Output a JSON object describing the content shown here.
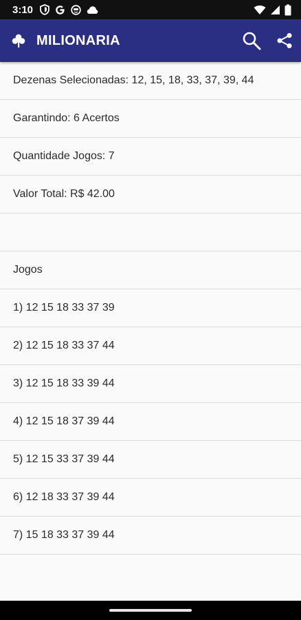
{
  "status_bar": {
    "time": "3:10",
    "left_icons": [
      "shield-icon",
      "google-icon",
      "face-icon",
      "cloud-icon"
    ],
    "right_icons": [
      "wifi-icon",
      "signal-icon",
      "battery-icon"
    ]
  },
  "app_bar": {
    "title": "MILIONARIA",
    "background": "#2b2f84",
    "logo_icon": "clover-icon",
    "actions": [
      "search-icon",
      "share-icon"
    ]
  },
  "summary": {
    "dezenas": "Dezenas Selecionadas: 12, 15, 18, 33, 37, 39, 44",
    "garantindo": "Garantindo: 6 Acertos",
    "quantidade": "Quantidade Jogos: 7",
    "valor": "Valor Total: R$ 42.00"
  },
  "jogos_header": "Jogos",
  "jogos": [
    "1) 12 15 18 33 37 39",
    "2) 12 15 18 33 37 44",
    "3) 12 15 18 33 39 44",
    "4) 12 15 18 37 39 44",
    "5) 12 15 33 37 39 44",
    "6) 12 18 33 37 39 44",
    "7) 15 18 33 37 39 44"
  ]
}
